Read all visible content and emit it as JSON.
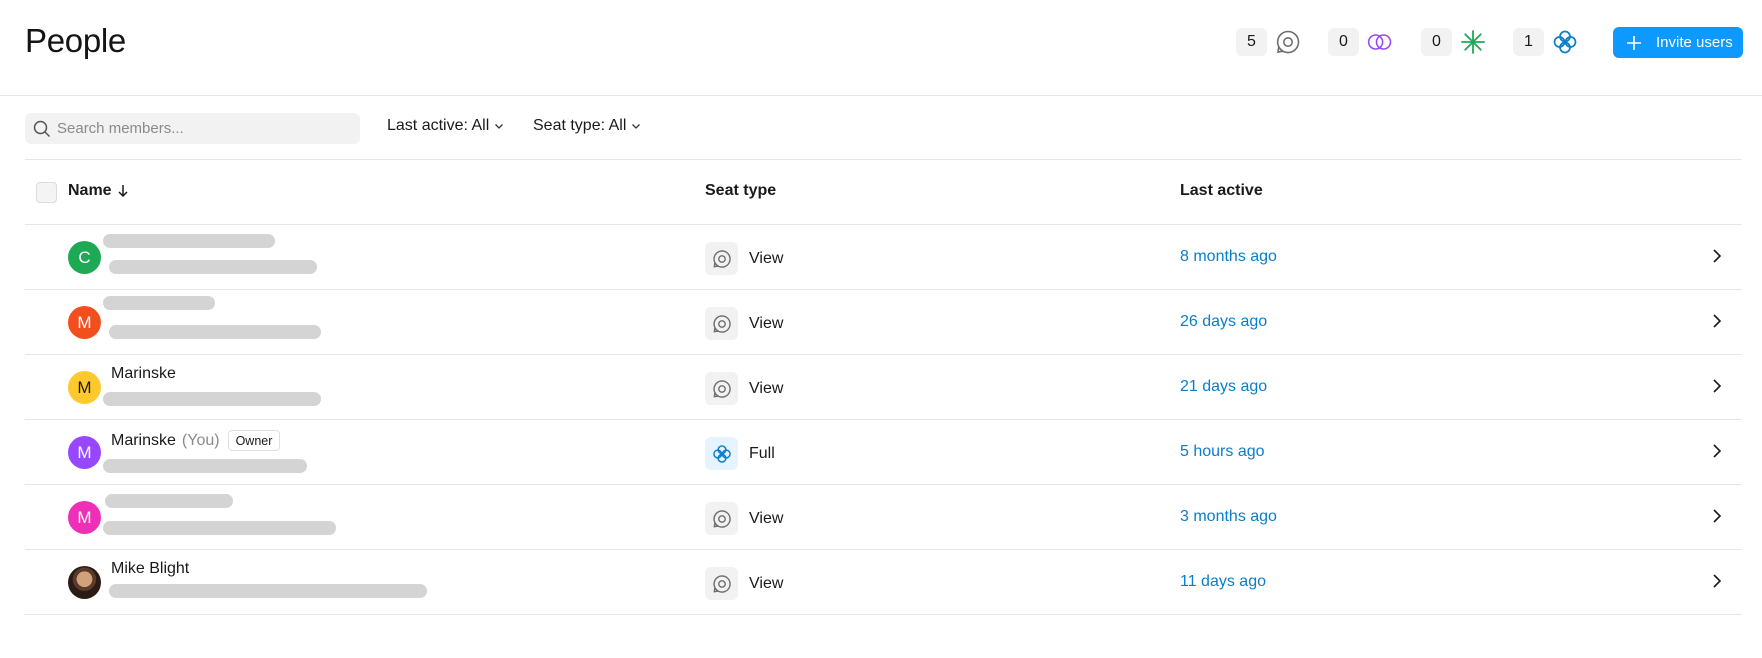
{
  "header": {
    "title": "People",
    "seat_counts": [
      {
        "count": "5",
        "icon": "view-seat-icon"
      },
      {
        "count": "0",
        "icon": "collab-seat-icon"
      },
      {
        "count": "0",
        "icon": "dev-seat-icon"
      },
      {
        "count": "1",
        "icon": "full-seat-icon"
      }
    ],
    "invite_label": "Invite users"
  },
  "toolbar": {
    "search_placeholder": "Search members...",
    "filter_last_active": "Last active: All",
    "filter_seat_type": "Seat type: All"
  },
  "table": {
    "columns": {
      "name": "Name",
      "seat_type": "Seat type",
      "last_active": "Last active"
    },
    "rows": [
      {
        "initial": "C",
        "name": "",
        "you": "",
        "badge": "",
        "seat": "View",
        "last_active": "8 months ago"
      },
      {
        "initial": "M",
        "name": "",
        "you": "",
        "badge": "",
        "seat": "View",
        "last_active": "26 days ago"
      },
      {
        "initial": "M",
        "name": "Marinske",
        "you": "",
        "badge": "",
        "seat": "View",
        "last_active": "21 days ago"
      },
      {
        "initial": "M",
        "name": "Marinske",
        "you": "(You)",
        "badge": "Owner",
        "seat": "Full",
        "last_active": "5 hours ago"
      },
      {
        "initial": "M",
        "name": "",
        "you": "",
        "badge": "",
        "seat": "View",
        "last_active": "3 months ago"
      },
      {
        "initial": "",
        "name": "Mike Blight",
        "you": "",
        "badge": "",
        "seat": "View",
        "last_active": "11 days ago"
      }
    ]
  },
  "colors": {
    "accent": "#0d99ff",
    "link": "#0a7ec9",
    "avatar_c": "#1eaa55",
    "avatar_m_red": "#f24e1e",
    "avatar_m_yellow": "#ffc92e",
    "avatar_m_purple": "#9747ff",
    "avatar_m_pink": "#ee2fb7"
  }
}
